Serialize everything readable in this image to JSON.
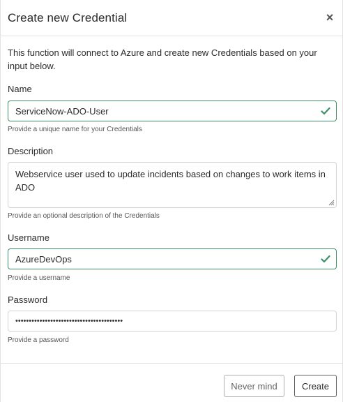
{
  "modal": {
    "title": "Create new Credential",
    "close_symbol": "×",
    "intro": "This function will connect to Azure and create new Credentials based on your input below."
  },
  "form": {
    "name": {
      "label": "Name",
      "value": "ServiceNow-ADO-User",
      "help": "Provide a unique name for your Credentials",
      "status": "valid"
    },
    "description": {
      "label": "Description",
      "value": "Webservice user used to update incidents based on changes to work items in ADO",
      "help": "Provide an optional description of the Credentials"
    },
    "username": {
      "label": "Username",
      "value": "AzureDevOps",
      "help": "Provide a username",
      "status": "valid"
    },
    "password": {
      "label": "Password",
      "value": "••••••••••••••••••••••••••••••••••••••••",
      "help": "Provide a password"
    }
  },
  "footer": {
    "cancel_label": "Never mind",
    "submit_label": "Create"
  },
  "colors": {
    "valid": "#3c8f67",
    "border": "#cfd4da",
    "divider": "#dee2e6"
  },
  "icons": {
    "close": "close-icon",
    "valid": "checkmark-icon",
    "resize": "resize-grip-icon"
  }
}
